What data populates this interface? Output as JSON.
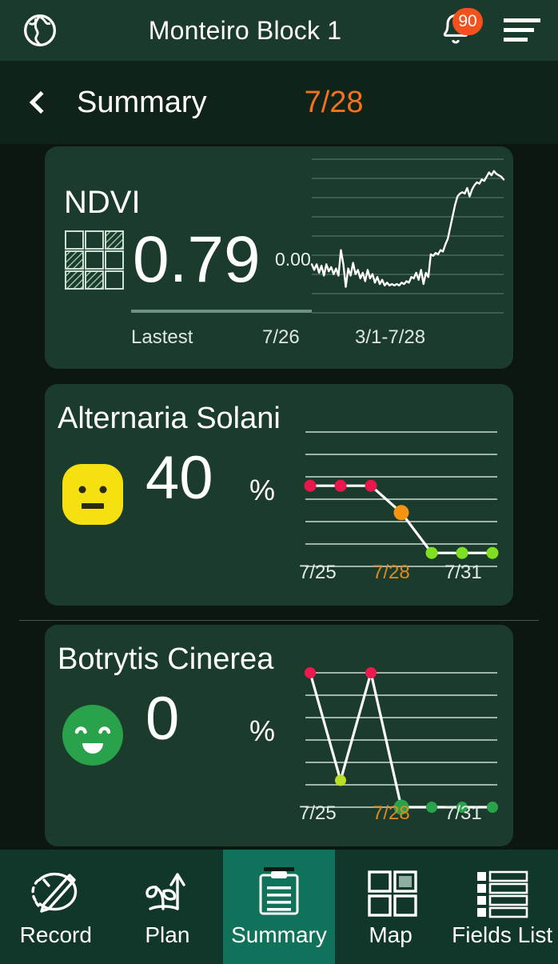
{
  "appbar": {
    "globe_icon": "globe-icon",
    "title": "Monteiro Block 1",
    "bell_icon": "bell-icon",
    "badge_count": "90",
    "menu_icon": "hamburger-menu-icon",
    "bg_color": "#1a3b2c"
  },
  "page_header": {
    "back_icon": "chevron-left-icon",
    "title": "Summary",
    "date": "7/28",
    "date_color": "#f4711e"
  },
  "ndvi_card": {
    "title": "NDVI",
    "grid_icon": "ndvi-grid-icon",
    "value": "0.79",
    "axis_min_label": "0.00",
    "latest_label": "Lastest",
    "latest_date": "7/26",
    "range_label": "3/1-7/28"
  },
  "diseases": [
    {
      "title": "Alternaria Solani",
      "face_icon": "neutral-face-icon",
      "face_color": "#f5e010",
      "value": "40",
      "unit": "%",
      "axis_labels": [
        "7/25",
        "7/28",
        "7/31"
      ]
    },
    {
      "title": "Botrytis Cinerea",
      "face_icon": "happy-face-icon",
      "face_color": "#2aa14b",
      "value": "0",
      "unit": "%",
      "axis_labels": [
        "7/25",
        "7/28",
        "7/31"
      ]
    }
  ],
  "bottom_nav": {
    "items": [
      {
        "label": "Record",
        "icon": "record-pencil-icon",
        "active": false
      },
      {
        "label": "Plan",
        "icon": "plant-growth-icon",
        "active": false
      },
      {
        "label": "Summary",
        "icon": "clipboard-icon",
        "active": true
      },
      {
        "label": "Map",
        "icon": "grid-map-icon",
        "active": false
      },
      {
        "label": "Fields List",
        "icon": "list-icon",
        "active": false
      }
    ],
    "active_color": "#10725a"
  },
  "chart_data": [
    {
      "type": "line",
      "name": "NDVI sparkline",
      "title": "NDVI",
      "xlabel": "3/1-7/28",
      "ylabel": "NDVI",
      "ylim": [
        0.0,
        1.0
      ],
      "grid": true,
      "gridlines": 8,
      "x": [
        0,
        1,
        2,
        3,
        4,
        5,
        6,
        7,
        8,
        9,
        10,
        11,
        12,
        13,
        14,
        15,
        16,
        17,
        18,
        19,
        20,
        21,
        22,
        23,
        24,
        25,
        26,
        27,
        28,
        29,
        30,
        31,
        32,
        33,
        34,
        35,
        36,
        37,
        38,
        39,
        40,
        41,
        42,
        43,
        44,
        45,
        46,
        47,
        48,
        49,
        50,
        51,
        52,
        53,
        54,
        55,
        56,
        57,
        58,
        59,
        60,
        61,
        62,
        63,
        64,
        65,
        66,
        67,
        68,
        69,
        70,
        71,
        72,
        73,
        74,
        75,
        76,
        77,
        78,
        79
      ],
      "values": [
        0.3,
        0.26,
        0.3,
        0.24,
        0.29,
        0.22,
        0.3,
        0.25,
        0.28,
        0.23,
        0.27,
        0.22,
        0.4,
        0.3,
        0.14,
        0.27,
        0.22,
        0.31,
        0.23,
        0.26,
        0.2,
        0.24,
        0.18,
        0.26,
        0.2,
        0.23,
        0.17,
        0.21,
        0.16,
        0.19,
        0.15,
        0.17,
        0.15,
        0.16,
        0.15,
        0.16,
        0.15,
        0.17,
        0.16,
        0.18,
        0.17,
        0.21,
        0.2,
        0.24,
        0.19,
        0.26,
        0.16,
        0.24,
        0.21,
        0.37,
        0.36,
        0.38,
        0.37,
        0.4,
        0.39,
        0.44,
        0.48,
        0.56,
        0.64,
        0.72,
        0.78,
        0.8,
        0.81,
        0.8,
        0.84,
        0.78,
        0.83,
        0.86,
        0.88,
        0.87,
        0.9,
        0.89,
        0.92,
        0.95,
        0.93,
        0.96,
        0.94,
        0.93,
        0.92,
        0.9
      ]
    },
    {
      "type": "line",
      "name": "Alternaria Solani risk",
      "title": "Alternaria Solani",
      "xlabel": "",
      "ylabel": "%",
      "ylim": [
        0,
        100
      ],
      "grid": true,
      "gridlines": 6,
      "categories": [
        "7/25",
        "7/26",
        "7/27",
        "7/28",
        "7/29",
        "7/30",
        "7/31"
      ],
      "values": [
        60,
        60,
        60,
        40,
        10,
        10,
        10
      ],
      "point_colors": [
        "#e8174b",
        "#e8174b",
        "#e8174b",
        "#f59410",
        "#7fe022",
        "#7fe022",
        "#7fe022"
      ],
      "highlight_index": 3
    },
    {
      "type": "line",
      "name": "Botrytis Cinerea risk",
      "title": "Botrytis Cinerea",
      "xlabel": "",
      "ylabel": "%",
      "ylim": [
        0,
        100
      ],
      "grid": true,
      "gridlines": 6,
      "categories": [
        "7/25",
        "7/26",
        "7/27",
        "7/28",
        "7/29",
        "7/30",
        "7/31"
      ],
      "values": [
        100,
        20,
        100,
        0,
        0,
        0,
        0
      ],
      "point_colors": [
        "#ec1a4e",
        "#b9e024",
        "#ec1a4e",
        "#2aa14b",
        "#2aa14b",
        "#2aa14b",
        "#2aa14b"
      ],
      "highlight_index": 3
    }
  ]
}
